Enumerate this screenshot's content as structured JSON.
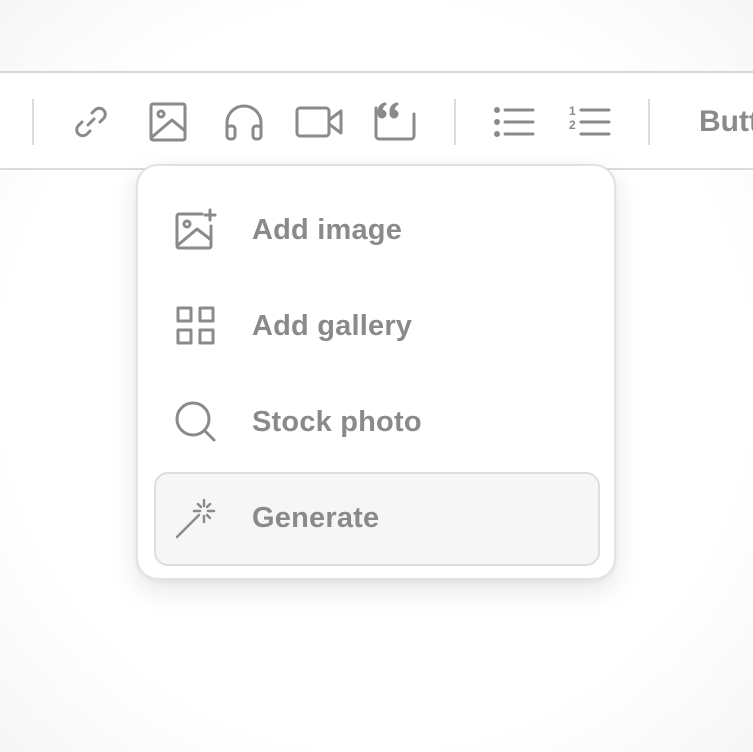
{
  "toolbar": {
    "buttons": [
      {
        "icon": "link-icon"
      },
      {
        "icon": "image-icon"
      },
      {
        "icon": "headphones-icon"
      },
      {
        "icon": "video-icon"
      },
      {
        "icon": "quote-icon"
      },
      {
        "icon": "bulleted-list-icon"
      },
      {
        "icon": "numbered-list-icon"
      }
    ],
    "truncated_label": "Butt"
  },
  "menu": {
    "items": [
      {
        "label": "Add image",
        "icon": "add-image-icon"
      },
      {
        "label": "Add gallery",
        "icon": "gallery-grid-icon"
      },
      {
        "label": "Stock photo",
        "icon": "search-icon"
      },
      {
        "label": "Generate",
        "icon": "magic-wand-icon",
        "highlighted": true
      }
    ]
  },
  "colors": {
    "icon": "#8a8a8a",
    "text": "#8a8a8a",
    "divider": "#dcdcdc",
    "highlight_bg": "#f6f6f6"
  }
}
